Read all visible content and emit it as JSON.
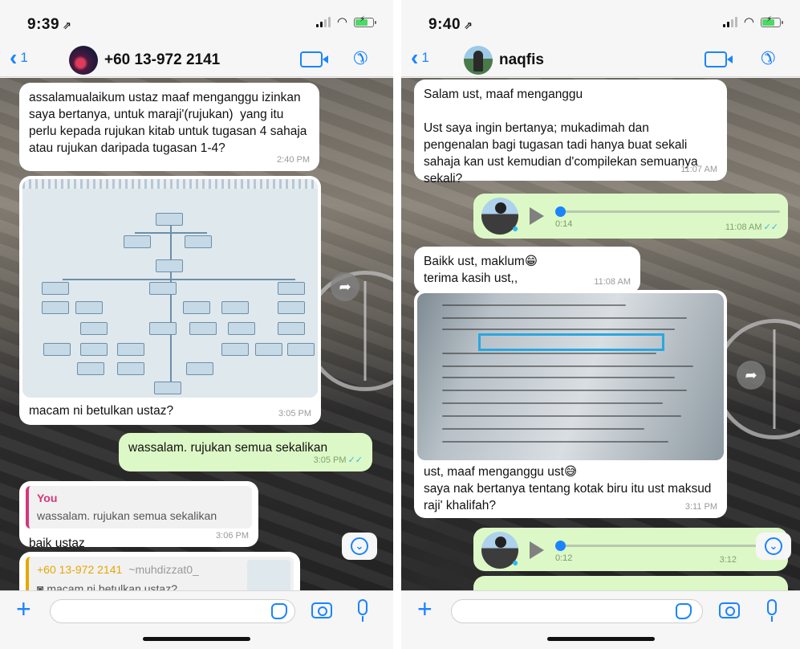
{
  "left": {
    "status": {
      "time": "9:39",
      "arrow": "⇗"
    },
    "nav": {
      "back_count": "1",
      "contact_name": "+60 13-972 2141"
    },
    "messages": [
      {
        "text": "assalamualaikum ustaz maaf menganggu izinkan saya bertanya, untuk maraji'(rujukan)  yang itu perlu kepada rujukan kitab untuk tugasan 4 sahaja atau rujukan daripada tugasan 1-4?",
        "time": "2:40 PM"
      },
      {
        "caption": "macam ni betulkan ustaz?",
        "time": "3:05 PM"
      },
      {
        "text": "wassalam. rujukan semua sekalikan",
        "time": "3:05 PM"
      },
      {
        "quote_author": "You",
        "quote_text": "wassalam. rujukan semua sekalikan",
        "text": "baik ustaz",
        "time": "3:06 PM"
      },
      {
        "forward_name": "+60 13-972 2141",
        "forward_user": "~muhdizzat0_",
        "forward_text": "macam ni betulkan ustaz?"
      }
    ]
  },
  "right": {
    "status": {
      "time": "9:40",
      "arrow": "⇗"
    },
    "nav": {
      "back_count": "1",
      "contact_name": "naqfis"
    },
    "messages": [
      {
        "text": "Salam ust, maaf menganggu\n\nUst saya ingin bertanya; mukadimah dan pengenalan bagi tugasan tadi hanya buat sekali sahaja kan ust kemudian d'compilekan semuanya sekali?",
        "time": "11:07 AM"
      },
      {
        "duration": "0:14",
        "time": "11:08 AM"
      },
      {
        "text": "Baikk ust, maklum😁\nterima kasih ust,,",
        "time": "11:08 AM"
      },
      {
        "caption": "ust, maaf menganggu ust😅\nsaya nak bertanya tentang kotak biru itu ust maksud raji' khalifah?",
        "time": "3:11 PM"
      },
      {
        "duration": "0:12",
        "time": "3:12"
      }
    ]
  },
  "icons": {
    "back": "chevron-left-icon",
    "video": "video-call-icon",
    "call": "phone-call-icon",
    "forward": "forward-icon",
    "scroll": "chevron-down-icon",
    "attach": "plus-icon",
    "sticker": "sticker-icon",
    "camera": "camera-icon",
    "mic": "microphone-icon"
  },
  "colors": {
    "accent": "#1a84ff",
    "outgoing_bubble": "#dcf8c6",
    "incoming_bubble": "#ffffff",
    "read_ticks": "#34b7f1",
    "quote_you": "#d6367a",
    "quote_forward": "#e6a700"
  }
}
